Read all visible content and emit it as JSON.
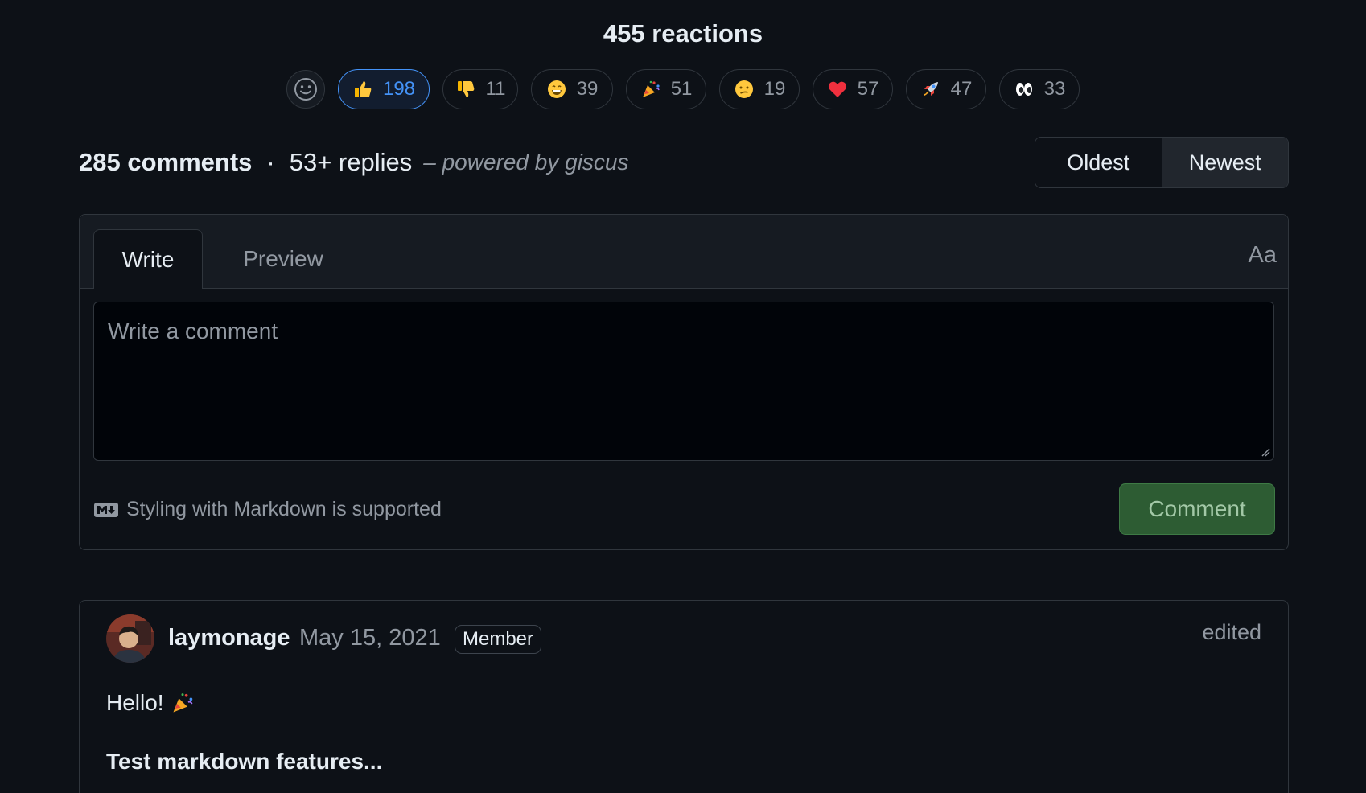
{
  "reactions": {
    "title": "455 reactions",
    "items": [
      {
        "emoji": "thumbs-up",
        "count": "198",
        "active": true
      },
      {
        "emoji": "thumbs-down",
        "count": "11",
        "active": false
      },
      {
        "emoji": "laugh",
        "count": "39",
        "active": false
      },
      {
        "emoji": "hooray",
        "count": "51",
        "active": false
      },
      {
        "emoji": "confused",
        "count": "19",
        "active": false
      },
      {
        "emoji": "heart",
        "count": "57",
        "active": false
      },
      {
        "emoji": "rocket",
        "count": "47",
        "active": false
      },
      {
        "emoji": "eyes",
        "count": "33",
        "active": false
      }
    ]
  },
  "comments_header": {
    "comments_count": "285 comments",
    "separator": "·",
    "replies_count": "53+ replies",
    "powered_by": "– powered by giscus"
  },
  "sort": {
    "oldest": "Oldest",
    "newest": "Newest",
    "selected": "Newest"
  },
  "editor": {
    "write_tab": "Write",
    "preview_tab": "Preview",
    "font_toggle": "Aa",
    "placeholder": "Write a comment",
    "markdown_note": "Styling with Markdown is supported",
    "submit_label": "Comment"
  },
  "comment": {
    "author": "laymonage",
    "date": "May 15, 2021",
    "badge": "Member",
    "edited": "edited",
    "body_line1": "Hello!",
    "body_heading": "Test markdown features..."
  },
  "colors": {
    "background": "#0d1117",
    "accent_blue": "#4493f8",
    "button_green": "#2d5c33",
    "border": "#30363d"
  }
}
